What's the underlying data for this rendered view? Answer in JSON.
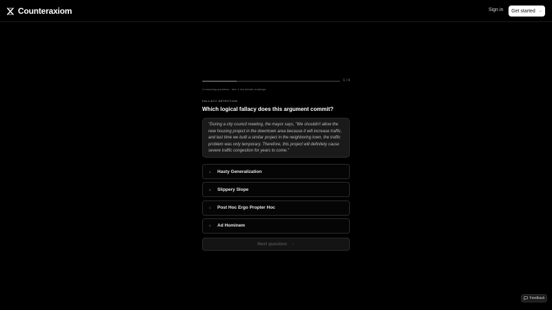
{
  "header": {
    "brand_name": "Counteraxiom",
    "sign_in_label": "Sign in",
    "get_started_label": "Get started",
    "get_started_icon": "arrow-right-icon"
  },
  "quiz": {
    "progress_text": "1 / 4",
    "progress_fraction": 0.25,
    "subtitle": "4 reasoning questions · then 1 live debate challenge",
    "section_label": "FALLACY DETECTION",
    "question": "Which logical fallacy does this argument commit?",
    "quote": "\"During a city council meeting, the mayor says, \"We shouldn't allow the new housing project in the downtown area because it will increase traffic, and last time we built a similar project in the neighboring town, the traffic problem was only temporary. Therefore, this project will definitely cause severe traffic congestion for years to come.\"",
    "options": [
      {
        "letter": "A",
        "label": "Hasty Generalization"
      },
      {
        "letter": "B",
        "label": "Slippery Slope"
      },
      {
        "letter": "C",
        "label": "Post Hoc Ergo Propter Hoc"
      },
      {
        "letter": "D",
        "label": "Ad Hominem"
      }
    ],
    "next_label": "Next question",
    "next_icon": "arrow-right-icon"
  },
  "feedback": {
    "label": "Feedback",
    "icon": "message-icon"
  },
  "colors": {
    "background": "#000000",
    "card": "#1a1a1a",
    "border": "#2d2d2d",
    "primary_button": "#ffffff"
  }
}
